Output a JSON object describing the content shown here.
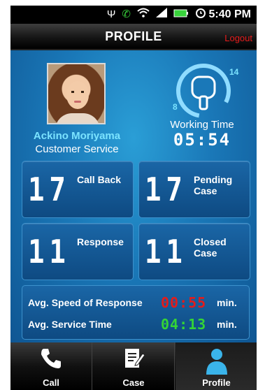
{
  "status_bar": {
    "time": "5:40 PM",
    "icons": [
      "usb-icon",
      "phone-call-icon",
      "wifi-icon",
      "signal-icon",
      "battery-icon",
      "alarm-icon"
    ]
  },
  "header": {
    "title": "PROFILE",
    "logout_label": "Logout"
  },
  "profile": {
    "name": "Ackino Moriyama",
    "role": "Customer Service"
  },
  "working_time": {
    "label": "Working Time",
    "value": "05:54",
    "gauge_top": "14",
    "gauge_bottom": "8"
  },
  "tiles": [
    {
      "value": "17",
      "label": "Call Back"
    },
    {
      "value": "17",
      "label": "Pending\nCase"
    },
    {
      "value": "11",
      "label": "Response"
    },
    {
      "value": "11",
      "label": "Closed\nCase"
    }
  ],
  "stats": [
    {
      "label": "Avg. Speed of Response",
      "value": "00:55",
      "unit": "min.",
      "color": "#e21c1c"
    },
    {
      "label": "Avg. Service Time",
      "value": "04:13",
      "unit": "min.",
      "color": "#34d436"
    }
  ],
  "tabs": [
    {
      "label": "Call",
      "icon": "phone-icon"
    },
    {
      "label": "Case",
      "icon": "case-edit-icon"
    },
    {
      "label": "Profile",
      "icon": "person-icon",
      "active": true
    }
  ],
  "colors": {
    "accent": "#1a78b8",
    "name_color": "#7be3ff",
    "logout_color": "#e61b1b"
  }
}
